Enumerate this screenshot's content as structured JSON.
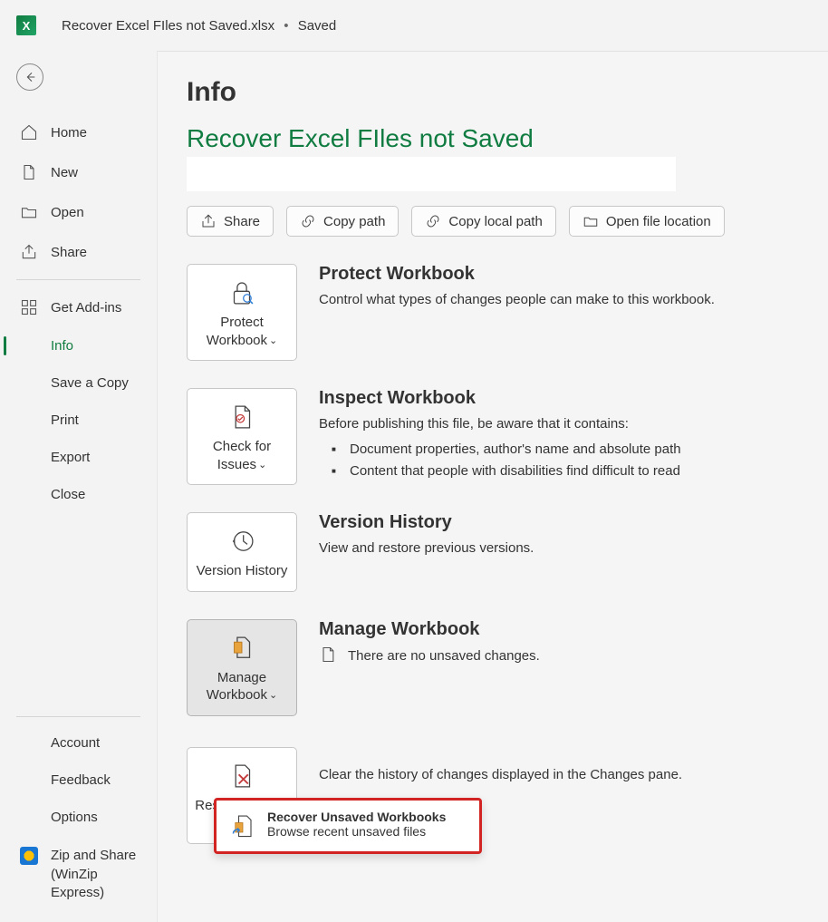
{
  "titlebar": {
    "doc": "Recover Excel FIles not Saved.xlsx",
    "status": "Saved"
  },
  "nav": {
    "home": "Home",
    "new": "New",
    "open": "Open",
    "share": "Share",
    "addins": "Get Add-ins",
    "info": "Info",
    "savecopy": "Save a Copy",
    "print": "Print",
    "export": "Export",
    "close": "Close",
    "account": "Account",
    "feedback": "Feedback",
    "options": "Options",
    "zip": "Zip and Share (WinZip Express)"
  },
  "page": {
    "title": "Info",
    "docTitle": "Recover Excel FIles not Saved"
  },
  "actions": {
    "share": "Share",
    "copypath": "Copy path",
    "copylocal": "Copy local path",
    "openloc": "Open file location"
  },
  "protect": {
    "btn": "Protect Workbook",
    "h": "Protect Workbook",
    "p": "Control what types of changes people can make to this workbook."
  },
  "inspect": {
    "btn": "Check for Issues",
    "h": "Inspect Workbook",
    "p": "Before publishing this file, be aware that it contains:",
    "b1": "Document properties, author's name and absolute path",
    "b2": "Content that people with disabilities find difficult to read"
  },
  "version": {
    "btn": "Version History",
    "h": "Version History",
    "p": "View and restore previous versions."
  },
  "manage": {
    "btn": "Manage Workbook",
    "h": "Manage Workbook",
    "line": "There are no unsaved changes."
  },
  "reset": {
    "btn": "Reset Changes Pane",
    "p": "Clear the history of changes displayed in the Changes pane."
  },
  "popup": {
    "t": "Recover Unsaved Workbooks",
    "s": "Browse recent unsaved files"
  }
}
